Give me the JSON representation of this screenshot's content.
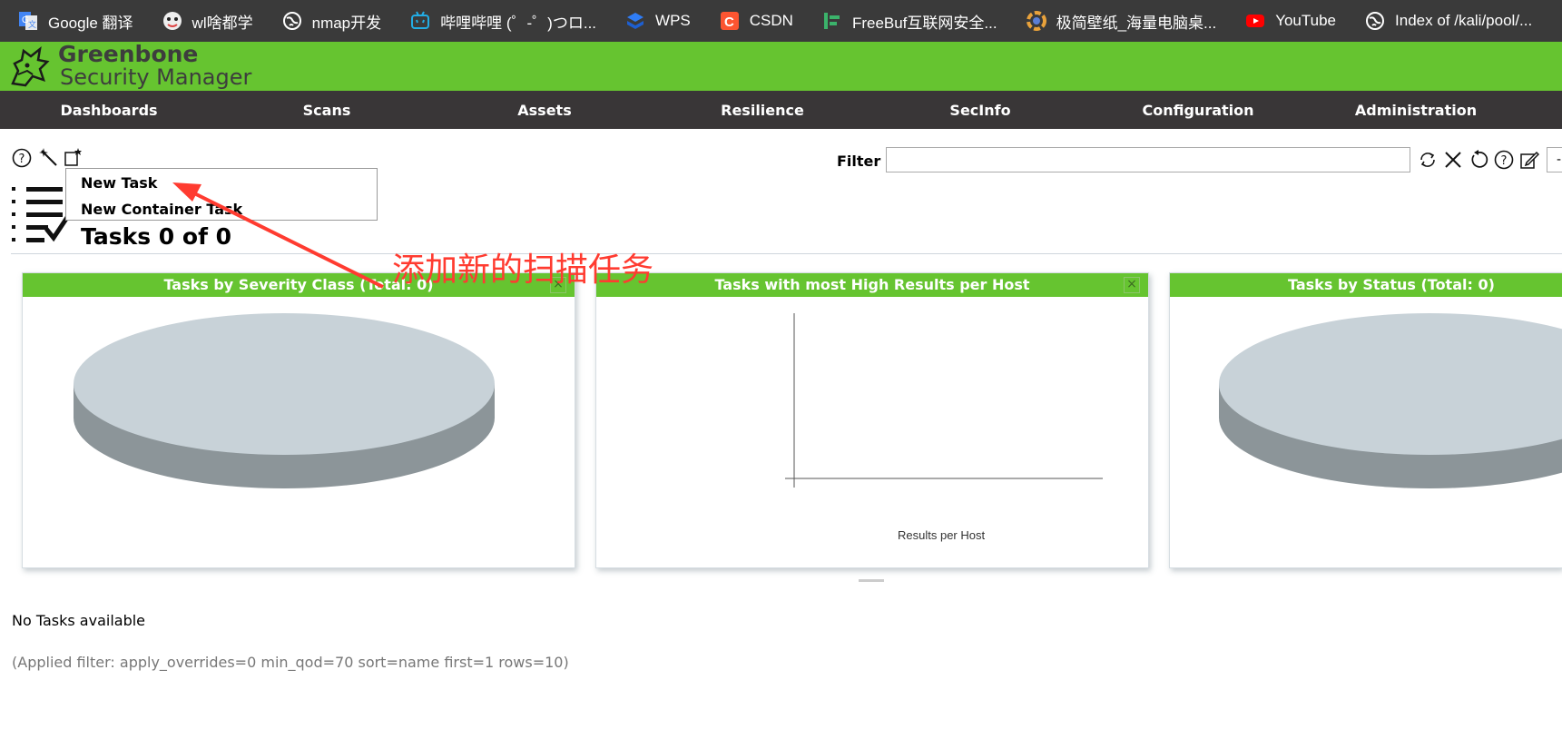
{
  "bookmarks": [
    {
      "label": "Google 翻译",
      "icon": "google-translate-icon"
    },
    {
      "label": "wl啥都学",
      "icon": "avatar-icon"
    },
    {
      "label": "nmap开发",
      "icon": "globe-icon"
    },
    {
      "label": "哔哩哔哩 (゜-゜)つロ...",
      "icon": "bilibili-icon"
    },
    {
      "label": "WPS",
      "icon": "wps-icon"
    },
    {
      "label": "CSDN",
      "icon": "csdn-icon"
    },
    {
      "label": "FreeBuf互联网安全...",
      "icon": "freebuf-icon"
    },
    {
      "label": "极简壁纸_海量电脑桌...",
      "icon": "wallpaper-icon"
    },
    {
      "label": "YouTube",
      "icon": "youtube-icon"
    },
    {
      "label": "Index of /kali/pool/...",
      "icon": "globe-icon"
    }
  ],
  "brand": {
    "line1": "Greenbone",
    "line2": "Security Manager"
  },
  "nav": [
    "Dashboards",
    "Scans",
    "Assets",
    "Resilience",
    "SecInfo",
    "Configuration",
    "Administration"
  ],
  "toolbar": {
    "icons": [
      "help-icon",
      "wizard-icon",
      "new-task-icon"
    ],
    "filter_label": "Filter",
    "filter_value": "",
    "filter_icons": [
      "refresh-icon",
      "clear-icon",
      "reset-icon",
      "help-icon",
      "edit-icon"
    ],
    "filter_select": "-"
  },
  "dropdown": {
    "items": [
      "New Task",
      "New Container Task"
    ]
  },
  "title": "Tasks 0 of 0",
  "annotation": "添加新的扫描任务",
  "panels": [
    {
      "title": "Tasks by Severity Class (Total: 0)",
      "chart": "pie"
    },
    {
      "title": "Tasks with most High Results per Host",
      "chart": "bar",
      "xlabel": "Results per Host"
    },
    {
      "title": "Tasks by Status (Total: 0)",
      "chart": "pie"
    }
  ],
  "empty_message": "No Tasks available",
  "applied_filter": "(Applied filter: apply_overrides=0 min_qod=70 sort=name first=1 rows=10)",
  "colors": {
    "brand_green": "#66c430",
    "nav_bg": "#393637",
    "pie_top": "#c8d2d8",
    "pie_side": "#8c9599",
    "annotation": "#ff3b30"
  },
  "chart_data": [
    {
      "type": "pie",
      "title": "Tasks by Severity Class (Total: 0)",
      "values": []
    },
    {
      "type": "bar",
      "title": "Tasks with most High Results per Host",
      "xlabel": "Results per Host",
      "categories": [],
      "values": []
    },
    {
      "type": "pie",
      "title": "Tasks by Status (Total: 0)",
      "values": []
    }
  ]
}
